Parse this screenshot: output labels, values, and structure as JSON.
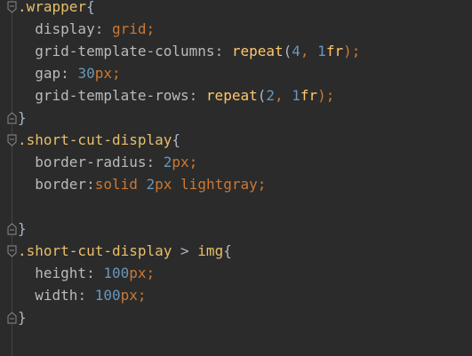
{
  "editor": {
    "lines": [
      {
        "fold": "close",
        "tokens": [
          {
            "t": ".wrapper",
            "c": "sel"
          },
          {
            "t": "{",
            "c": "brace"
          }
        ]
      },
      {
        "fold": "",
        "tokens": [
          {
            "t": "  display",
            "c": "prop"
          },
          {
            "t": ": ",
            "c": "op"
          },
          {
            "t": "grid",
            "c": "kw"
          },
          {
            "t": ";",
            "c": "kw"
          }
        ]
      },
      {
        "fold": "",
        "tokens": [
          {
            "t": "  grid-template-columns",
            "c": "prop"
          },
          {
            "t": ": ",
            "c": "op"
          },
          {
            "t": "repeat",
            "c": "fn"
          },
          {
            "t": "(",
            "c": "op"
          },
          {
            "t": "4",
            "c": "num"
          },
          {
            "t": ", ",
            "c": "kw"
          },
          {
            "t": "1",
            "c": "num"
          },
          {
            "t": "fr",
            "c": "fn"
          },
          {
            "t": ");",
            "c": "kw"
          }
        ]
      },
      {
        "fold": "",
        "tokens": [
          {
            "t": "  gap",
            "c": "prop"
          },
          {
            "t": ": ",
            "c": "op"
          },
          {
            "t": "30",
            "c": "num"
          },
          {
            "t": "px",
            "c": "kw"
          },
          {
            "t": ";",
            "c": "kw"
          }
        ]
      },
      {
        "fold": "",
        "tokens": [
          {
            "t": "  grid-template-rows",
            "c": "prop"
          },
          {
            "t": ": ",
            "c": "op"
          },
          {
            "t": "repeat",
            "c": "fn"
          },
          {
            "t": "(",
            "c": "op"
          },
          {
            "t": "2",
            "c": "num"
          },
          {
            "t": ", ",
            "c": "kw"
          },
          {
            "t": "1",
            "c": "num"
          },
          {
            "t": "fr",
            "c": "fn"
          },
          {
            "t": ");",
            "c": "kw"
          }
        ]
      },
      {
        "fold": "end",
        "tokens": [
          {
            "t": "}",
            "c": "brace"
          }
        ]
      },
      {
        "fold": "open",
        "tokens": [
          {
            "t": ".short-cut-display",
            "c": "sel"
          },
          {
            "t": "{",
            "c": "brace"
          }
        ]
      },
      {
        "fold": "",
        "tokens": [
          {
            "t": "  border-radius",
            "c": "prop"
          },
          {
            "t": ": ",
            "c": "op"
          },
          {
            "t": "2",
            "c": "num"
          },
          {
            "t": "px",
            "c": "kw"
          },
          {
            "t": ";",
            "c": "kw"
          }
        ]
      },
      {
        "fold": "",
        "tokens": [
          {
            "t": "  border",
            "c": "prop"
          },
          {
            "t": ":",
            "c": "op"
          },
          {
            "t": "solid ",
            "c": "kw"
          },
          {
            "t": "2",
            "c": "num"
          },
          {
            "t": "px ",
            "c": "kw"
          },
          {
            "t": "lightgray",
            "c": "kw"
          },
          {
            "t": ";",
            "c": "kw"
          }
        ]
      },
      {
        "fold": "",
        "tokens": []
      },
      {
        "fold": "end",
        "tokens": [
          {
            "t": "}",
            "c": "brace"
          }
        ]
      },
      {
        "fold": "open",
        "tokens": [
          {
            "t": ".short-cut-display",
            "c": "sel"
          },
          {
            "t": " > ",
            "c": "op"
          },
          {
            "t": "img",
            "c": "sel"
          },
          {
            "t": "{",
            "c": "brace"
          }
        ]
      },
      {
        "fold": "",
        "tokens": [
          {
            "t": "  height",
            "c": "prop"
          },
          {
            "t": ": ",
            "c": "op"
          },
          {
            "t": "100",
            "c": "num"
          },
          {
            "t": "px",
            "c": "kw"
          },
          {
            "t": ";",
            "c": "kw"
          }
        ]
      },
      {
        "fold": "",
        "tokens": [
          {
            "t": "  width",
            "c": "prop"
          },
          {
            "t": ": ",
            "c": "op"
          },
          {
            "t": "100",
            "c": "num"
          },
          {
            "t": "px",
            "c": "kw"
          },
          {
            "t": ";",
            "c": "kw"
          }
        ]
      },
      {
        "fold": "end",
        "tokens": [
          {
            "t": "}",
            "c": "brace"
          }
        ]
      }
    ]
  },
  "colors": {
    "background": "#2b2b2b",
    "selector": "#e8bf6a",
    "property": "#bababa",
    "keyword": "#cc7832",
    "number": "#6897bb",
    "function": "#ffc66d"
  }
}
